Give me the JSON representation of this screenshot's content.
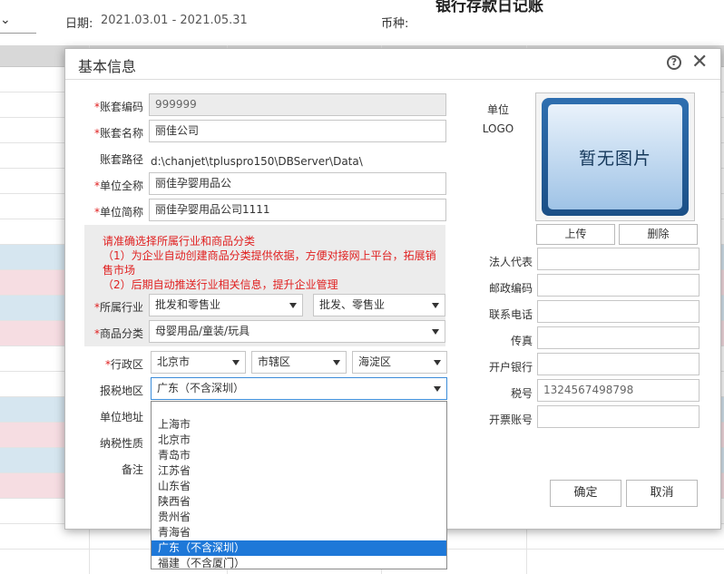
{
  "background": {
    "date_label": "日期:",
    "date_range": "2021.03.01 - 2021.05.31",
    "currency_label": "币种:",
    "report_title": "银行存款日记账"
  },
  "dialog": {
    "title": "基本信息",
    "fields": {
      "account_code": {
        "label": "账套编码",
        "value": "999999"
      },
      "account_name": {
        "label": "账套名称",
        "value": "丽佳公司"
      },
      "account_path": {
        "label": "账套路径",
        "value": "d:\\chanjet\\tpluspro150\\DBServer\\Data\\"
      },
      "unit_full_name": {
        "label": "单位全称",
        "value": "丽佳孕婴用品公"
      },
      "unit_short_name": {
        "label": "单位简称",
        "value": "丽佳孕婴用品公司1111"
      }
    },
    "notice": {
      "line1": "请准确选择所属行业和商品分类",
      "line2": "（1）为企业自动创建商品分类提供依据，方便对接网上平台，拓展销售市场",
      "line3": "（2）后期自动推送行业相关信息，提升企业管理"
    },
    "industry": {
      "label": "所属行业",
      "value1": "批发和零售业",
      "value2": "批发、零售业"
    },
    "product_category": {
      "label": "商品分类",
      "value": "母婴用品/童装/玩具"
    },
    "region": {
      "label": "行政区",
      "province": "北京市",
      "district": "市辖区",
      "county": "海淀区"
    },
    "tax_region": {
      "label": "报税地区",
      "value": "广东（不含深圳）",
      "options": [
        "",
        "上海市",
        "北京市",
        "青岛市",
        "江苏省",
        "山东省",
        "陕西省",
        "贵州省",
        "青海省",
        "广东（不含深圳）",
        "福建（不含厦门）"
      ],
      "selected_index": 9
    },
    "unit_address": {
      "label": "单位地址"
    },
    "tax_nature": {
      "label": "纳税性质"
    },
    "remarks": {
      "label": "备注"
    },
    "logo": {
      "label_line1": "单位",
      "label_line2": "LOGO",
      "placeholder": "暂无图片",
      "upload": "上传",
      "delete": "删除"
    },
    "right_fields": {
      "legal_rep": {
        "label": "法人代表",
        "value": ""
      },
      "postal_code": {
        "label": "邮政编码",
        "value": ""
      },
      "phone": {
        "label": "联系电话",
        "value": ""
      },
      "fax": {
        "label": "传真",
        "value": ""
      },
      "bank": {
        "label": "开户银行",
        "value": ""
      },
      "tax_number": {
        "label": "税号",
        "value": "1324567498798"
      },
      "invoice_account": {
        "label": "开票账号",
        "value": ""
      }
    },
    "buttons": {
      "confirm": "确定",
      "cancel": "取消"
    }
  }
}
